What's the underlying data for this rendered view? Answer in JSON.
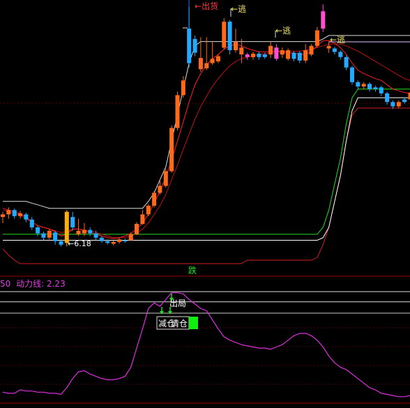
{
  "colors": {
    "background": "#000000",
    "up_candle": "#ff6a1a",
    "up_candle_alt": "#ffb000",
    "down_candle": "#22aaff",
    "highlight_candle": "#ff4fd0",
    "band_upper": "#ffffff",
    "band_green": "#20dd20",
    "band_red": "#d02020",
    "ma_red": "#ff2020",
    "divider": "#9a0000",
    "oscillator": "#dd30dd"
  },
  "labels": {
    "out_of_stock": "出货",
    "escape_1": "逃",
    "escape_2": "逃",
    "escape_3": "逃",
    "low_price": "6.18",
    "fall": "跌",
    "exit": "出局",
    "reduce_position": "减仓",
    "clear_position": "清仓",
    "indicator_prefix": "50",
    "indicator_name": "动力线:",
    "indicator_value": "2.23"
  },
  "icons": {
    "arrow_down": "down-arrow-icon"
  },
  "chart_data": [
    {
      "type": "candlestick",
      "title": "",
      "low_price_label": 6.18,
      "candles": [
        {
          "o": 6.52,
          "c": 6.55,
          "h": 6.58,
          "l": 6.45,
          "k": "up"
        },
        {
          "o": 6.55,
          "c": 6.6,
          "h": 6.63,
          "l": 6.5,
          "k": "up"
        },
        {
          "o": 6.6,
          "c": 6.53,
          "h": 6.62,
          "l": 6.5,
          "k": "down"
        },
        {
          "o": 6.53,
          "c": 6.56,
          "h": 6.59,
          "l": 6.5,
          "k": "up"
        },
        {
          "o": 6.55,
          "c": 6.49,
          "h": 6.57,
          "l": 6.46,
          "k": "down"
        },
        {
          "o": 6.49,
          "c": 6.4,
          "h": 6.52,
          "l": 6.37,
          "k": "down"
        },
        {
          "o": 6.4,
          "c": 6.33,
          "h": 6.42,
          "l": 6.3,
          "k": "down"
        },
        {
          "o": 6.33,
          "c": 6.28,
          "h": 6.35,
          "l": 6.25,
          "k": "down"
        },
        {
          "o": 6.28,
          "c": 6.36,
          "h": 6.38,
          "l": 6.26,
          "k": "up"
        },
        {
          "o": 6.34,
          "c": 6.24,
          "h": 6.36,
          "l": 6.2,
          "k": "down"
        },
        {
          "o": 6.24,
          "c": 6.2,
          "h": 6.26,
          "l": 6.18,
          "k": "down"
        },
        {
          "o": 6.22,
          "c": 6.58,
          "h": 6.6,
          "l": 6.18,
          "k": "up2"
        },
        {
          "o": 6.52,
          "c": 6.4,
          "h": 6.58,
          "l": 6.36,
          "k": "down"
        },
        {
          "o": 6.36,
          "c": 6.32,
          "h": 6.5,
          "l": 6.3,
          "k": "up"
        },
        {
          "o": 6.33,
          "c": 6.37,
          "h": 6.45,
          "l": 6.3,
          "k": "up"
        },
        {
          "o": 6.37,
          "c": 6.33,
          "h": 6.4,
          "l": 6.3,
          "k": "down"
        },
        {
          "o": 6.33,
          "c": 6.28,
          "h": 6.36,
          "l": 6.25,
          "k": "down"
        },
        {
          "o": 6.28,
          "c": 6.24,
          "h": 6.3,
          "l": 6.22,
          "k": "down"
        },
        {
          "o": 6.24,
          "c": 6.22,
          "h": 6.26,
          "l": 6.2,
          "k": "down"
        },
        {
          "o": 6.21,
          "c": 6.23,
          "h": 6.25,
          "l": 6.19,
          "k": "up"
        },
        {
          "o": 6.23,
          "c": 6.26,
          "h": 6.28,
          "l": 6.21,
          "k": "up"
        },
        {
          "o": 6.25,
          "c": 6.24,
          "h": 6.27,
          "l": 6.22,
          "k": "down"
        },
        {
          "o": 6.25,
          "c": 6.32,
          "h": 6.34,
          "l": 6.24,
          "k": "up"
        },
        {
          "o": 6.32,
          "c": 6.44,
          "h": 6.46,
          "l": 6.31,
          "k": "up"
        },
        {
          "o": 6.44,
          "c": 6.55,
          "h": 6.6,
          "l": 6.43,
          "k": "up"
        },
        {
          "o": 6.55,
          "c": 6.65,
          "h": 6.67,
          "l": 6.53,
          "k": "up"
        },
        {
          "o": 6.65,
          "c": 6.8,
          "h": 6.82,
          "l": 6.63,
          "k": "up"
        },
        {
          "o": 6.8,
          "c": 6.88,
          "h": 6.95,
          "l": 6.78,
          "k": "up"
        },
        {
          "o": 6.88,
          "c": 7.05,
          "h": 7.08,
          "l": 6.86,
          "k": "up"
        },
        {
          "o": 7.05,
          "c": 7.55,
          "h": 7.58,
          "l": 7.03,
          "k": "up"
        },
        {
          "o": 7.55,
          "c": 7.93,
          "h": 7.97,
          "l": 7.52,
          "k": "up"
        },
        {
          "o": 7.93,
          "c": 8.1,
          "h": 8.15,
          "l": 7.9,
          "k": "up"
        },
        {
          "o": 8.3,
          "c": 8.7,
          "h": 8.95,
          "l": 8.25,
          "k": "down"
        },
        {
          "o": 8.58,
          "c": 8.42,
          "h": 8.62,
          "l": 8.38,
          "k": "down"
        },
        {
          "o": 8.36,
          "c": 8.23,
          "h": 8.6,
          "l": 8.2,
          "k": "up"
        },
        {
          "o": 8.3,
          "c": 8.24,
          "h": 8.6,
          "l": 8.22,
          "k": "up"
        },
        {
          "o": 8.35,
          "c": 8.3,
          "h": 8.55,
          "l": 8.28,
          "k": "up"
        },
        {
          "o": 8.32,
          "c": 8.38,
          "h": 8.4,
          "l": 8.3,
          "k": "up"
        },
        {
          "o": 8.48,
          "c": 8.78,
          "h": 8.82,
          "l": 8.46,
          "k": "up"
        },
        {
          "o": 8.78,
          "c": 8.45,
          "h": 8.8,
          "l": 8.4,
          "k": "down"
        },
        {
          "o": 8.45,
          "c": 8.55,
          "h": 8.7,
          "l": 8.42,
          "k": "up"
        },
        {
          "o": 8.48,
          "c": 8.4,
          "h": 8.58,
          "l": 8.3,
          "k": "up"
        },
        {
          "o": 8.4,
          "c": 8.37,
          "h": 8.42,
          "l": 8.34,
          "k": "pink"
        },
        {
          "o": 8.37,
          "c": 8.41,
          "h": 8.43,
          "l": 8.34,
          "k": "up"
        },
        {
          "o": 8.41,
          "c": 8.37,
          "h": 8.43,
          "l": 8.34,
          "k": "down"
        },
        {
          "o": 8.37,
          "c": 8.4,
          "h": 8.42,
          "l": 8.35,
          "k": "down"
        },
        {
          "o": 8.4,
          "c": 8.5,
          "h": 8.55,
          "l": 8.36,
          "k": "up"
        },
        {
          "o": 8.48,
          "c": 8.35,
          "h": 8.52,
          "l": 8.33,
          "k": "pink"
        },
        {
          "o": 8.4,
          "c": 8.45,
          "h": 8.48,
          "l": 8.36,
          "k": "up"
        },
        {
          "o": 8.45,
          "c": 8.35,
          "h": 8.47,
          "l": 8.33,
          "k": "up"
        },
        {
          "o": 8.35,
          "c": 8.42,
          "h": 8.44,
          "l": 8.32,
          "k": "down"
        },
        {
          "o": 8.42,
          "c": 8.33,
          "h": 8.44,
          "l": 8.3,
          "k": "down"
        },
        {
          "o": 8.33,
          "c": 8.45,
          "h": 8.52,
          "l": 8.3,
          "k": "up"
        },
        {
          "o": 8.4,
          "c": 8.5,
          "h": 8.52,
          "l": 8.38,
          "k": "up"
        },
        {
          "o": 8.5,
          "c": 8.68,
          "h": 8.72,
          "l": 8.48,
          "k": "up"
        },
        {
          "o": 8.7,
          "c": 8.9,
          "h": 8.98,
          "l": 8.66,
          "k": "pink"
        },
        {
          "o": 8.5,
          "c": 8.47,
          "h": 8.55,
          "l": 8.42,
          "k": "up"
        },
        {
          "o": 8.47,
          "c": 8.43,
          "h": 8.49,
          "l": 8.4,
          "k": "down"
        },
        {
          "o": 8.43,
          "c": 8.37,
          "h": 8.45,
          "l": 8.34,
          "k": "down"
        },
        {
          "o": 8.37,
          "c": 8.25,
          "h": 8.39,
          "l": 8.22,
          "k": "down"
        },
        {
          "o": 8.25,
          "c": 8.08,
          "h": 8.27,
          "l": 8.05,
          "k": "down"
        },
        {
          "o": 8.08,
          "c": 8.03,
          "h": 8.1,
          "l": 8.0,
          "k": "down"
        },
        {
          "o": 8.03,
          "c": 8.06,
          "h": 8.08,
          "l": 8.0,
          "k": "up"
        },
        {
          "o": 8.06,
          "c": 8.0,
          "h": 8.08,
          "l": 7.97,
          "k": "down"
        },
        {
          "o": 8.0,
          "c": 8.02,
          "h": 8.04,
          "l": 7.97,
          "k": "down"
        },
        {
          "o": 8.02,
          "c": 7.95,
          "h": 8.04,
          "l": 7.92,
          "k": "down"
        },
        {
          "o": 7.95,
          "c": 7.85,
          "h": 7.97,
          "l": 7.82,
          "k": "down"
        },
        {
          "o": 7.85,
          "c": 7.8,
          "h": 7.87,
          "l": 7.77,
          "k": "down"
        },
        {
          "o": 7.8,
          "c": 7.85,
          "h": 7.87,
          "l": 7.78,
          "k": "up"
        },
        {
          "o": 7.85,
          "c": 7.88,
          "h": 7.9,
          "l": 7.83,
          "k": "down"
        },
        {
          "o": 7.88,
          "c": 7.96,
          "h": 8.0,
          "l": 7.86,
          "k": "up"
        }
      ],
      "bands": {
        "upper_white": [
          6.7,
          6.7,
          6.7,
          6.7,
          6.7,
          6.68,
          6.66,
          6.64,
          6.62,
          6.62,
          6.62,
          6.62,
          6.62,
          6.62,
          6.62,
          6.62,
          6.62,
          6.62,
          6.62,
          6.62,
          6.62,
          6.62,
          6.62,
          6.62,
          6.62,
          6.7,
          6.8,
          6.95,
          7.1,
          7.4,
          7.7,
          8.0,
          8.3,
          8.5,
          8.55,
          8.55,
          8.55,
          8.55,
          8.55,
          8.55,
          8.55,
          8.55,
          8.55,
          8.55,
          8.55,
          8.55,
          8.55,
          8.55,
          8.55,
          8.55,
          8.55,
          8.55,
          8.55,
          8.55,
          8.55,
          8.58,
          8.62,
          8.62,
          8.62,
          8.62,
          8.62,
          8.62,
          8.62,
          8.62,
          8.62,
          8.62,
          8.62,
          8.62,
          8.62,
          8.62,
          8.62
        ],
        "green": [
          6.32,
          6.32,
          6.32,
          6.32,
          6.32,
          6.32,
          6.32,
          6.32,
          6.32,
          6.32,
          6.32,
          6.32,
          6.32,
          6.32,
          6.32,
          6.32,
          6.32,
          6.32,
          6.32,
          6.32,
          6.32,
          6.32,
          6.32,
          6.32,
          6.32,
          6.32,
          6.32,
          6.32,
          6.32,
          6.32,
          6.32,
          6.32,
          6.32,
          6.32,
          6.32,
          6.32,
          6.32,
          6.32,
          6.32,
          6.32,
          6.32,
          6.32,
          6.32,
          6.32,
          6.32,
          6.32,
          6.32,
          6.32,
          6.32,
          6.32,
          6.32,
          6.32,
          6.32,
          6.32,
          6.32,
          6.4,
          6.6,
          6.9,
          7.2,
          7.6,
          7.9,
          8.0,
          8.0,
          8.0,
          8.0,
          8.0,
          8.0,
          8.0,
          8.0,
          8.0,
          8.0
        ],
        "lower_white": [
          6.25,
          6.25,
          6.25,
          6.25,
          6.25,
          6.25,
          6.25,
          6.25,
          6.25,
          6.25,
          6.25,
          6.25,
          6.25,
          6.25,
          6.25,
          6.25,
          6.25,
          6.25,
          6.25,
          6.25,
          6.25,
          6.25,
          6.25,
          6.25,
          6.25,
          6.25,
          6.25,
          6.25,
          6.25,
          6.25,
          6.25,
          6.25,
          6.25,
          6.25,
          6.25,
          6.25,
          6.25,
          6.25,
          6.25,
          6.25,
          6.25,
          6.25,
          6.25,
          6.25,
          6.25,
          6.25,
          6.25,
          6.25,
          6.25,
          6.25,
          6.25,
          6.25,
          6.25,
          6.25,
          6.25,
          6.28,
          6.4,
          6.7,
          7.0,
          7.4,
          7.75,
          7.9,
          7.9,
          7.9,
          7.9,
          7.9,
          7.9,
          7.9,
          7.9,
          7.9,
          7.9
        ],
        "lower_red": [
          6.15,
          6.08,
          6.02,
          5.98,
          5.98,
          5.98,
          5.98,
          5.98,
          5.98,
          5.98,
          5.98,
          5.98,
          5.98,
          5.98,
          5.98,
          5.98,
          5.98,
          5.98,
          5.98,
          5.98,
          5.98,
          5.98,
          5.98,
          5.98,
          5.98,
          5.98,
          5.98,
          5.98,
          5.98,
          5.98,
          5.98,
          5.98,
          5.98,
          5.98,
          5.98,
          5.98,
          5.98,
          5.98,
          5.98,
          5.98,
          5.98,
          5.98,
          6.02,
          6.02,
          6.02,
          6.02,
          6.02,
          6.02,
          6.02,
          6.02,
          6.02,
          6.02,
          6.02,
          6.02,
          6.05,
          6.2,
          6.4,
          6.7,
          7.0,
          7.4,
          7.7,
          7.78,
          7.78,
          7.78,
          7.78,
          7.78,
          7.78,
          7.78,
          7.78,
          7.78,
          7.78
        ],
        "ma_red_1": [
          6.62,
          6.6,
          6.58,
          6.56,
          6.52,
          6.46,
          6.42,
          6.4,
          6.38,
          6.35,
          6.3,
          6.32,
          6.38,
          6.38,
          6.36,
          6.34,
          6.32,
          6.3,
          6.28,
          6.27,
          6.28,
          6.3,
          6.33,
          6.38,
          6.45,
          6.55,
          6.68,
          6.82,
          6.98,
          7.18,
          7.4,
          7.62,
          7.85,
          8.05,
          8.18,
          8.28,
          8.35,
          8.4,
          8.46,
          8.5,
          8.52,
          8.5,
          8.47,
          8.45,
          8.43,
          8.43,
          8.44,
          8.44,
          8.43,
          8.42,
          8.42,
          8.4,
          8.4,
          8.44,
          8.5,
          8.56,
          8.56,
          8.53,
          8.48,
          8.4,
          8.3,
          8.22,
          8.18,
          8.15,
          8.12,
          8.1,
          8.05,
          8.0,
          7.98,
          7.96,
          7.95
        ],
        "ma_red_2": [
          6.6,
          6.58,
          6.56,
          6.54,
          6.5,
          6.46,
          6.42,
          6.4,
          6.38,
          6.36,
          6.34,
          6.35,
          6.38,
          6.38,
          6.37,
          6.36,
          6.34,
          6.32,
          6.3,
          6.28,
          6.28,
          6.28,
          6.3,
          6.33,
          6.38,
          6.45,
          6.55,
          6.65,
          6.78,
          6.95,
          7.12,
          7.3,
          7.48,
          7.65,
          7.8,
          7.92,
          8.03,
          8.12,
          8.2,
          8.27,
          8.32,
          8.35,
          8.37,
          8.38,
          8.4,
          8.41,
          8.42,
          8.43,
          8.43,
          8.44,
          8.44,
          8.44,
          8.45,
          8.46,
          8.48,
          8.5,
          8.52,
          8.52,
          8.52,
          8.5,
          8.47,
          8.44,
          8.4,
          8.36,
          8.32,
          8.28,
          8.24,
          8.2,
          8.16,
          8.12,
          8.1
        ]
      }
    },
    {
      "type": "line",
      "title": "",
      "series": [
        {
          "name": "动力线",
          "values": [
            6,
            5,
            5,
            8,
            7,
            7,
            6,
            6,
            5,
            5,
            4,
            10,
            18,
            24,
            25,
            22,
            20,
            18,
            17,
            17,
            18,
            20,
            28,
            45,
            62,
            80,
            85,
            82,
            88,
            94,
            94,
            93,
            88,
            84,
            80,
            78,
            70,
            62,
            55,
            52,
            50,
            48,
            47,
            46,
            45,
            45,
            44,
            46,
            48,
            52,
            56,
            58,
            58,
            56,
            52,
            46,
            38,
            32,
            28,
            26,
            22,
            18,
            14,
            10,
            8,
            5,
            4,
            3,
            2,
            2,
            3
          ],
          "last_value": 2.23
        }
      ],
      "reference_lines": [
        95,
        86
      ]
    }
  ]
}
